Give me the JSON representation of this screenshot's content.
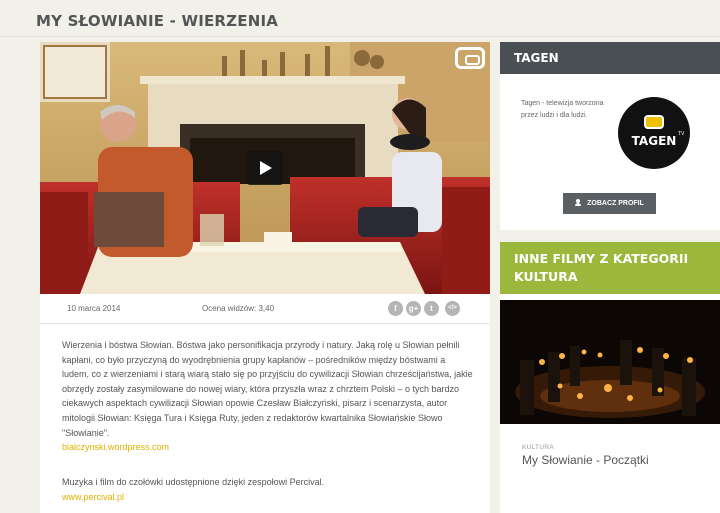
{
  "page": {
    "title": "MY SŁOWIANIE - WIERZENIA"
  },
  "video": {
    "date": "10 marca 2014",
    "rating": "Ocena widzów: 3,40",
    "share_icons": [
      "facebook-icon",
      "google-plus-icon",
      "twitter-icon",
      "embed-icon"
    ],
    "share_glyphs": [
      "f",
      "g+",
      "t",
      "</>"
    ]
  },
  "description": {
    "text": "Wierzenia i bóstwa Słowian. Bóstwa jako personifikacja przyrody i natury. Jaką rolę u Słowian pełnili kapłani, co było przyczyną do wyodrębnienia grupy kapłanów – pośredników między bóstwami a ludem, co z wierzeniami i starą wiarą stało się po przyjściu do cywilizacji Słowian chrześcijaństwa, jakie obrzędy zostały zasymilowane do nowej wiary, która przyszła wraz z chrztem Polski – o tych bardzo ciekawych aspektach cywilizacji Słowian opowie Czesław Białczyński, pisarz i scenarzysta, autor mitologii Słowian: Księga Tura i Księga Ruty, jeden z redaktorów kwartalnika Słowiańskie Słowo \"Słowianie\".",
    "link": "bialczynski.wordpress.com",
    "credits": "Muzyka i film do czołówki udostępnione dzięki zespołowi Percival.",
    "credits_link": "www.percival.pl"
  },
  "sidebar": {
    "channel": {
      "heading": "TAGEN",
      "text": "Tagen - telewizja tworzona przez ludzi i dla ludzi.",
      "logo_text": "TAGEN",
      "logo_sup": "TV",
      "profile_button": "ZOBACZ PROFIL"
    },
    "related": {
      "heading": "INNE FILMY Z KATEGORII KULTURA",
      "category": "KULTURA",
      "title": "My Słowianie - Początki"
    }
  },
  "colors": {
    "accent_green": "#9bb73c",
    "link_yellow": "#e0b200",
    "header_dark": "#4a4f53"
  }
}
